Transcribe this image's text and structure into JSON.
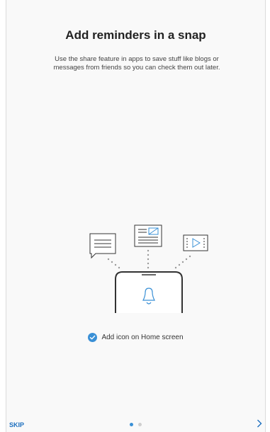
{
  "title": "Add reminders in a snap",
  "subtitle": "Use the share feature in apps to save stuff like blogs or messages from friends so you can check them out later.",
  "illustration": {
    "icons": [
      "message-icon",
      "article-icon",
      "video-icon",
      "phone-icon",
      "bell-icon"
    ]
  },
  "checkbox": {
    "label": "Add icon on Home screen",
    "checked": true
  },
  "footer": {
    "skip_label": "SKIP",
    "page_count": 2,
    "current_page": 1
  },
  "colors": {
    "accent": "#3a90d6",
    "skip": "#1d6fbf",
    "text": "#222222",
    "background": "#f9f9f9"
  }
}
